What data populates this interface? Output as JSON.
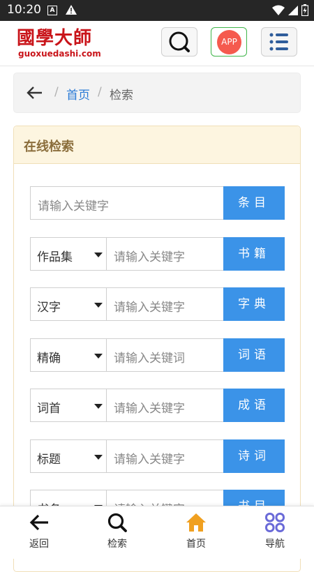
{
  "status_bar": {
    "time": "10:20",
    "notif_letter": "A"
  },
  "header": {
    "logo_cn": "國學大師",
    "logo_en": "guoxuedashi.com",
    "app_button": "APP"
  },
  "breadcrumb": {
    "sep": "/",
    "home": "首页",
    "current": "检索"
  },
  "panel": {
    "title": "在线检索",
    "rows": [
      {
        "select": null,
        "placeholder": "请输入关键字",
        "button": "条目"
      },
      {
        "select": "作品集",
        "placeholder": "请输入关键字",
        "button": "书籍"
      },
      {
        "select": "汉字",
        "placeholder": "请输入关键字",
        "button": "字典"
      },
      {
        "select": "精确",
        "placeholder": "请输入关键词",
        "button": "词语"
      },
      {
        "select": "词首",
        "placeholder": "请输入关键字",
        "button": "成语"
      },
      {
        "select": "标题",
        "placeholder": "请输入关键字",
        "button": "诗词"
      },
      {
        "select": "书名",
        "placeholder": "请输入关键字",
        "button": "书目"
      }
    ]
  },
  "bottom_nav": [
    {
      "label": "返回",
      "icon": "back-arrow-icon"
    },
    {
      "label": "检索",
      "icon": "search-icon"
    },
    {
      "label": "首页",
      "icon": "home-icon"
    },
    {
      "label": "导航",
      "icon": "grid-icon"
    }
  ],
  "colors": {
    "accent": "#3b93e8",
    "brand": "#c9141a",
    "home_icon": "#f0a020",
    "nav_icon": "#6a6ad8"
  }
}
